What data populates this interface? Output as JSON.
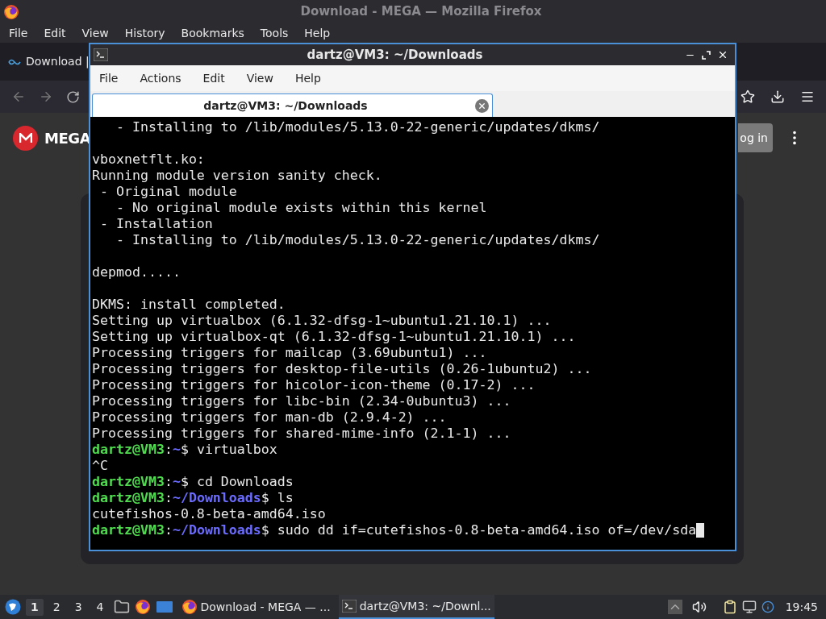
{
  "browser": {
    "title": "Download - MEGA — Mozilla Firefox",
    "menu": [
      "File",
      "Edit",
      "View",
      "History",
      "Bookmarks",
      "Tools",
      "Help"
    ],
    "tab": {
      "label": "Download |"
    },
    "page": {
      "logo_text": "MEGA",
      "login_button": "og in"
    }
  },
  "terminal": {
    "title": "dartz@VM3: ~/Downloads",
    "menu": [
      "File",
      "Actions",
      "Edit",
      "View",
      "Help"
    ],
    "tabs": [
      {
        "label": "dartz@VM3: ~/Downloads",
        "selected": true
      }
    ],
    "lines": [
      {
        "kind": "text",
        "text": "   - Installing to /lib/modules/5.13.0-22-generic/updates/dkms/"
      },
      {
        "kind": "blank"
      },
      {
        "kind": "text",
        "text": "vboxnetflt.ko:"
      },
      {
        "kind": "text",
        "text": "Running module version sanity check."
      },
      {
        "kind": "text",
        "text": " - Original module"
      },
      {
        "kind": "text",
        "text": "   - No original module exists within this kernel"
      },
      {
        "kind": "text",
        "text": " - Installation"
      },
      {
        "kind": "text",
        "text": "   - Installing to /lib/modules/5.13.0-22-generic/updates/dkms/"
      },
      {
        "kind": "blank"
      },
      {
        "kind": "text",
        "text": "depmod....."
      },
      {
        "kind": "blank"
      },
      {
        "kind": "text",
        "text": "DKMS: install completed."
      },
      {
        "kind": "text",
        "text": "Setting up virtualbox (6.1.32-dfsg-1~ubuntu1.21.10.1) ..."
      },
      {
        "kind": "text",
        "text": "Setting up virtualbox-qt (6.1.32-dfsg-1~ubuntu1.21.10.1) ..."
      },
      {
        "kind": "text",
        "text": "Processing triggers for mailcap (3.69ubuntu1) ..."
      },
      {
        "kind": "text",
        "text": "Processing triggers for desktop-file-utils (0.26-1ubuntu2) ..."
      },
      {
        "kind": "text",
        "text": "Processing triggers for hicolor-icon-theme (0.17-2) ..."
      },
      {
        "kind": "text",
        "text": "Processing triggers for libc-bin (2.34-0ubuntu3) ..."
      },
      {
        "kind": "text",
        "text": "Processing triggers for man-db (2.9.4-2) ..."
      },
      {
        "kind": "text",
        "text": "Processing triggers for shared-mime-info (2.1-1) ..."
      },
      {
        "kind": "prompt",
        "user_host": "dartz@VM3",
        "separator": ":",
        "path": "~",
        "command": "$ virtualbox",
        "cursor": false
      },
      {
        "kind": "text",
        "text": "^C"
      },
      {
        "kind": "prompt",
        "user_host": "dartz@VM3",
        "separator": ":",
        "path": "~",
        "command": "$ cd Downloads",
        "cursor": false
      },
      {
        "kind": "prompt",
        "user_host": "dartz@VM3",
        "separator": ":",
        "path": "~/Downloads",
        "command": "$ ls",
        "cursor": false
      },
      {
        "kind": "text",
        "text": "cutefishos-0.8-beta-amd64.iso"
      },
      {
        "kind": "prompt",
        "user_host": "dartz@VM3",
        "separator": ":",
        "path": "~/Downloads",
        "command": "$ sudo dd if=cutefishos-0.8-beta-amd64.iso of=/dev/sda",
        "cursor": true
      }
    ]
  },
  "taskbar": {
    "workspaces": [
      {
        "label": "1",
        "selected": true
      },
      {
        "label": "2",
        "selected": false
      },
      {
        "label": "3",
        "selected": false
      },
      {
        "label": "4",
        "selected": false
      }
    ],
    "tasks": [
      {
        "kind": "browser",
        "label": "Download - MEGA — ...",
        "selected": false
      },
      {
        "kind": "terminal",
        "label": "dartz@VM3: ~/Downl...",
        "selected": true
      }
    ],
    "clock": "19:45"
  }
}
